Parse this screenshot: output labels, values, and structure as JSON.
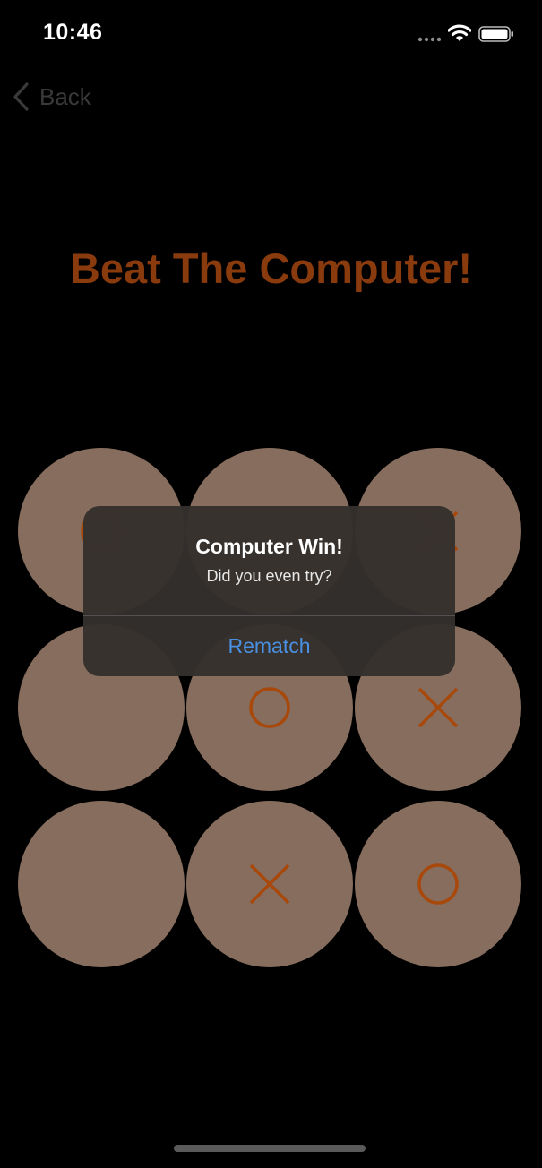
{
  "status_bar": {
    "time": "10:46",
    "icons": [
      "cellular-signal-icon",
      "wifi-icon",
      "battery-icon"
    ]
  },
  "nav": {
    "back_label": "Back",
    "back_icon": "chevron-left-icon"
  },
  "title": "Beat The Computer!",
  "board": {
    "cells": [
      "O",
      "",
      "X",
      "",
      "O",
      "X",
      "",
      "X",
      "O"
    ],
    "cell_color": "#866d5d",
    "mark_color": "#a8480b"
  },
  "alert": {
    "title": "Computer Win!",
    "message": "Did you even try?",
    "button_label": "Rematch",
    "button_color": "#4a90e2"
  },
  "colors": {
    "background": "#000000",
    "title": "#8a3b0e"
  }
}
